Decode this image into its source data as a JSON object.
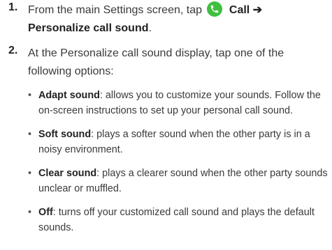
{
  "steps": [
    {
      "number": "1.",
      "text_before_icon": "From the main Settings screen, tap",
      "icon": "phone-icon",
      "icon_label": "Call",
      "arrow": "➔",
      "target": "Personalize call sound",
      "end": "."
    },
    {
      "number": "2.",
      "text": "At the Personalize call sound display, tap one of the following options:"
    }
  ],
  "options": [
    {
      "term": "Adapt sound",
      "description": ": allows you to customize your sounds. Follow the on-screen instructions to set up your personal call sound."
    },
    {
      "term": "Soft sound",
      "description": ": plays a softer sound when the other party is in a noisy environment."
    },
    {
      "term": "Clear sound",
      "description": ": plays a clearer sound when the other party sounds unclear or muffled."
    },
    {
      "term": "Off",
      "description": ": turns off your customized call sound and plays the default sounds."
    }
  ],
  "bullet_glyph": "•",
  "colors": {
    "text": "#3a3a3a",
    "call_icon_bg": "#3fbf3f"
  }
}
